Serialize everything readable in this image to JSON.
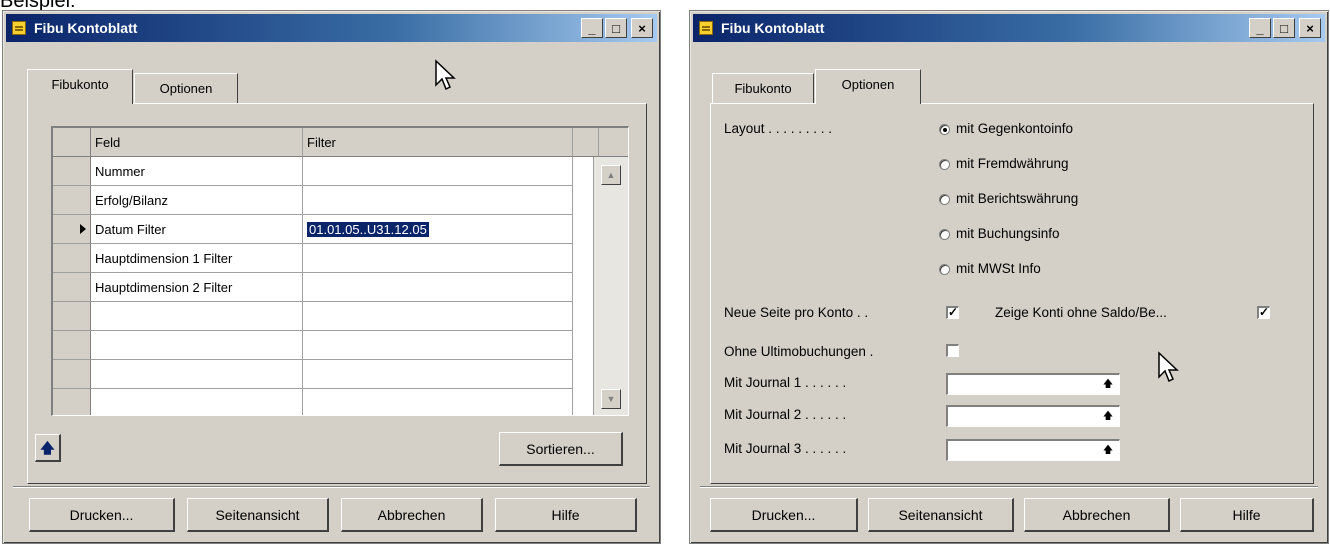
{
  "page_caption": "Beispiel:",
  "left_window": {
    "title": "Fibu Kontoblatt",
    "tabs": [
      "Fibukonto",
      "Optionen"
    ],
    "grid": {
      "headers": [
        "Feld",
        "Filter"
      ],
      "rows": [
        {
          "feld": "Nummer",
          "filter": ""
        },
        {
          "feld": "Erfolg/Bilanz",
          "filter": ""
        },
        {
          "feld": "Datum Filter",
          "filter": "01.01.05..U31.12.05"
        },
        {
          "feld": "Hauptdimension 1 Filter",
          "filter": ""
        },
        {
          "feld": "Hauptdimension 2 Filter",
          "filter": ""
        },
        {
          "feld": "",
          "filter": ""
        },
        {
          "feld": "",
          "filter": ""
        },
        {
          "feld": "",
          "filter": ""
        },
        {
          "feld": "",
          "filter": ""
        }
      ]
    },
    "sort_button": "Sortieren...",
    "buttons": [
      "Drucken...",
      "Seitenansicht",
      "Abbrechen",
      "Hilfe"
    ]
  },
  "right_window": {
    "title": "Fibu Kontoblatt",
    "tabs": [
      "Fibukonto",
      "Optionen"
    ],
    "layout_label": "Layout . . . . . . . . .",
    "layout_options": [
      {
        "label": "mit Gegenkontoinfo",
        "selected": true
      },
      {
        "label": "mit Fremdwährung",
        "selected": false
      },
      {
        "label": "mit Berichtswährung",
        "selected": false
      },
      {
        "label": "mit Buchungsinfo",
        "selected": false
      },
      {
        "label": "mit MWSt Info",
        "selected": false
      }
    ],
    "neue_seite_label": "Neue Seite pro Konto . .",
    "neue_seite_checked": true,
    "zeige_konti_label": "Zeige Konti ohne Saldo/Be...",
    "zeige_konti_checked": true,
    "ohne_ultimo_label": "Ohne Ultimobuchungen .",
    "ohne_ultimo_checked": false,
    "journals": [
      {
        "label": "Mit Journal 1 . . . . . .",
        "value": ""
      },
      {
        "label": "Mit Journal 2 . . . . . .",
        "value": ""
      },
      {
        "label": "Mit Journal 3 . . . . . .",
        "value": ""
      }
    ],
    "buttons": [
      "Drucken...",
      "Seitenansicht",
      "Abbrechen",
      "Hilfe"
    ]
  },
  "window_controls": {
    "minimize": "_",
    "maximize": "□",
    "close": "×"
  }
}
